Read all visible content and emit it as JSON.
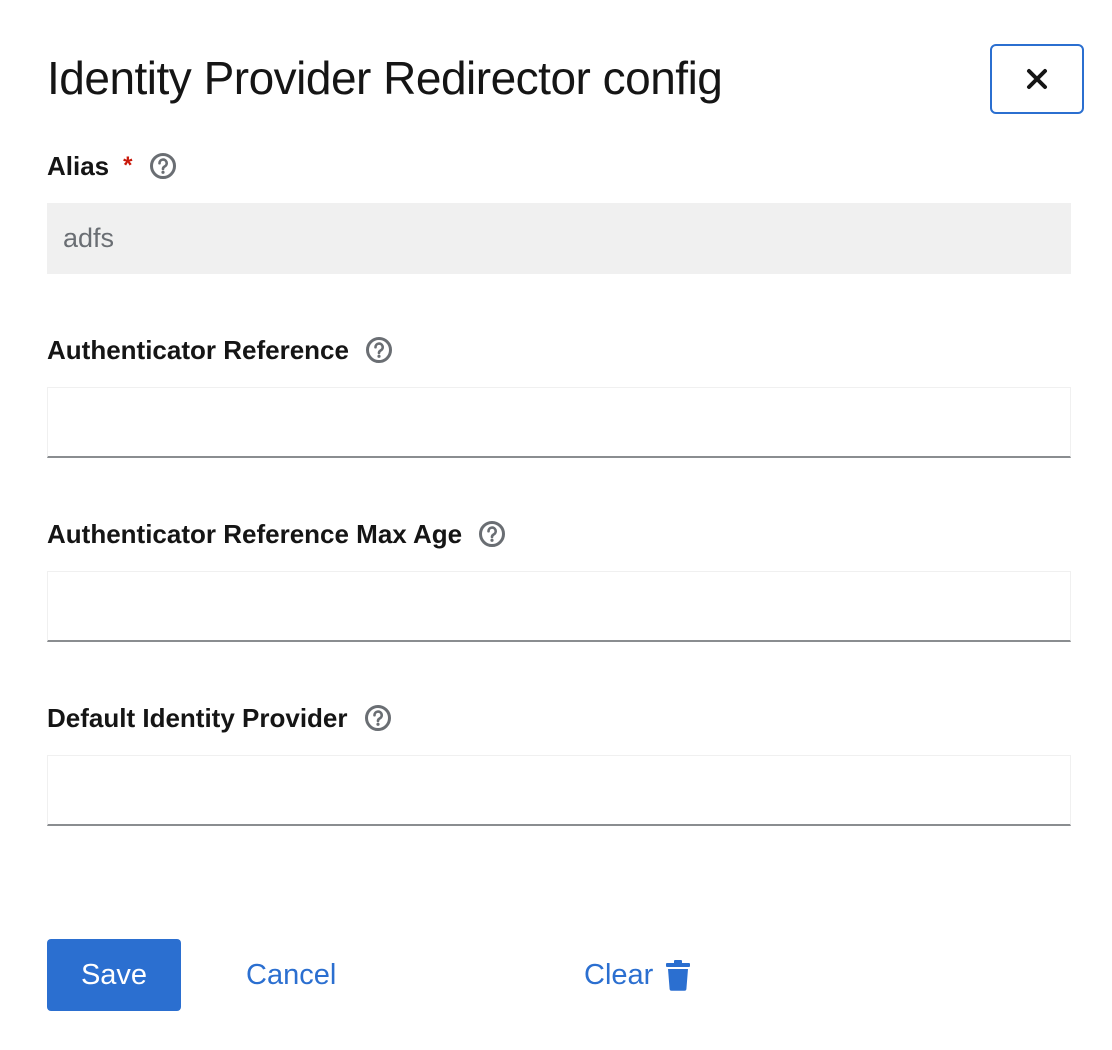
{
  "modal": {
    "title": "Identity Provider Redirector config",
    "close_icon": "close-icon"
  },
  "fields": {
    "alias": {
      "label": "Alias",
      "required_mark": "*",
      "value": "adfs",
      "help_icon": "help-circle-icon"
    },
    "auth_ref": {
      "label": "Authenticator Reference",
      "value": "",
      "help_icon": "help-circle-icon"
    },
    "auth_ref_max_age": {
      "label": "Authenticator Reference Max Age",
      "value": "",
      "help_icon": "help-circle-icon"
    },
    "default_idp": {
      "label": "Default Identity Provider",
      "value": "",
      "help_icon": "help-circle-icon"
    }
  },
  "actions": {
    "save_label": "Save",
    "cancel_label": "Cancel",
    "clear_label": "Clear",
    "clear_icon": "trash-icon"
  },
  "colors": {
    "primary": "#2b6fd0",
    "required": "#c9190b",
    "readonly_bg": "#f0f0f0",
    "text": "#151515"
  }
}
